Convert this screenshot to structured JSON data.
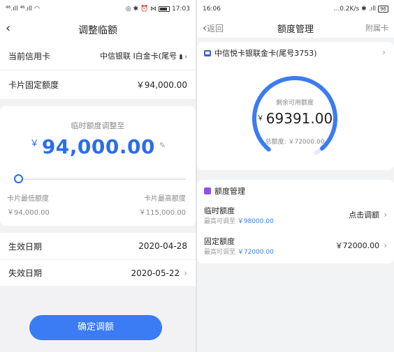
{
  "left": {
    "status": {
      "time": "17:03",
      "left_signal": "⁴⁶.ıll ⁴⁶.ıll",
      "right_icons": "◎ ✱ ⏰ ⋈"
    },
    "nav": {
      "title": "调整临额"
    },
    "current_card": {
      "label": "当前信用卡",
      "value": "中信银联 I白金卡(尾号"
    },
    "fixed_limit": {
      "label": "卡片固定额度",
      "value": "￥94,000.00"
    },
    "adjust": {
      "hint": "临时额度调整至",
      "currency": "￥",
      "amount": "94,000.00",
      "slider_fraction": 0.0,
      "min_label": "卡片最低额度",
      "min_value": "￥94,000.00",
      "max_label": "卡片最高额度",
      "max_value": "￥115,000.00"
    },
    "effective_date": {
      "label": "生效日期",
      "value": "2020-04-28"
    },
    "expiry_date": {
      "label": "失效日期",
      "value": "2020-05-22"
    },
    "confirm_label": "确定调额"
  },
  "right": {
    "status": {
      "time": "16:06",
      "speed": "...0.2K/s",
      "battery": "96"
    },
    "nav": {
      "back_label": "返回",
      "title": "额度管理",
      "extra_label": "附属卡"
    },
    "card": {
      "title": "中信悦卡银联金卡(尾号3753)",
      "remaining_label": "剩余可用额度",
      "currency": "￥",
      "remaining_value": "69391.00",
      "total_label": "总额度: ￥72000.00",
      "usage_fraction": 0.9638
    },
    "mgmt": {
      "title": "额度管理",
      "temp": {
        "label": "临时额度",
        "sub_prefix": "最高可调至",
        "sub_value": "￥98000.00",
        "action": "点击调额"
      },
      "fixed": {
        "label": "固定额度",
        "sub_prefix": "最高可调至",
        "sub_value": "￥72000.00",
        "value": "￥72000.00"
      }
    }
  },
  "colors": {
    "accent": "#3b7bf3",
    "amount_blue": "#2a6cf0",
    "gauge_track": "#e6eaf2"
  }
}
